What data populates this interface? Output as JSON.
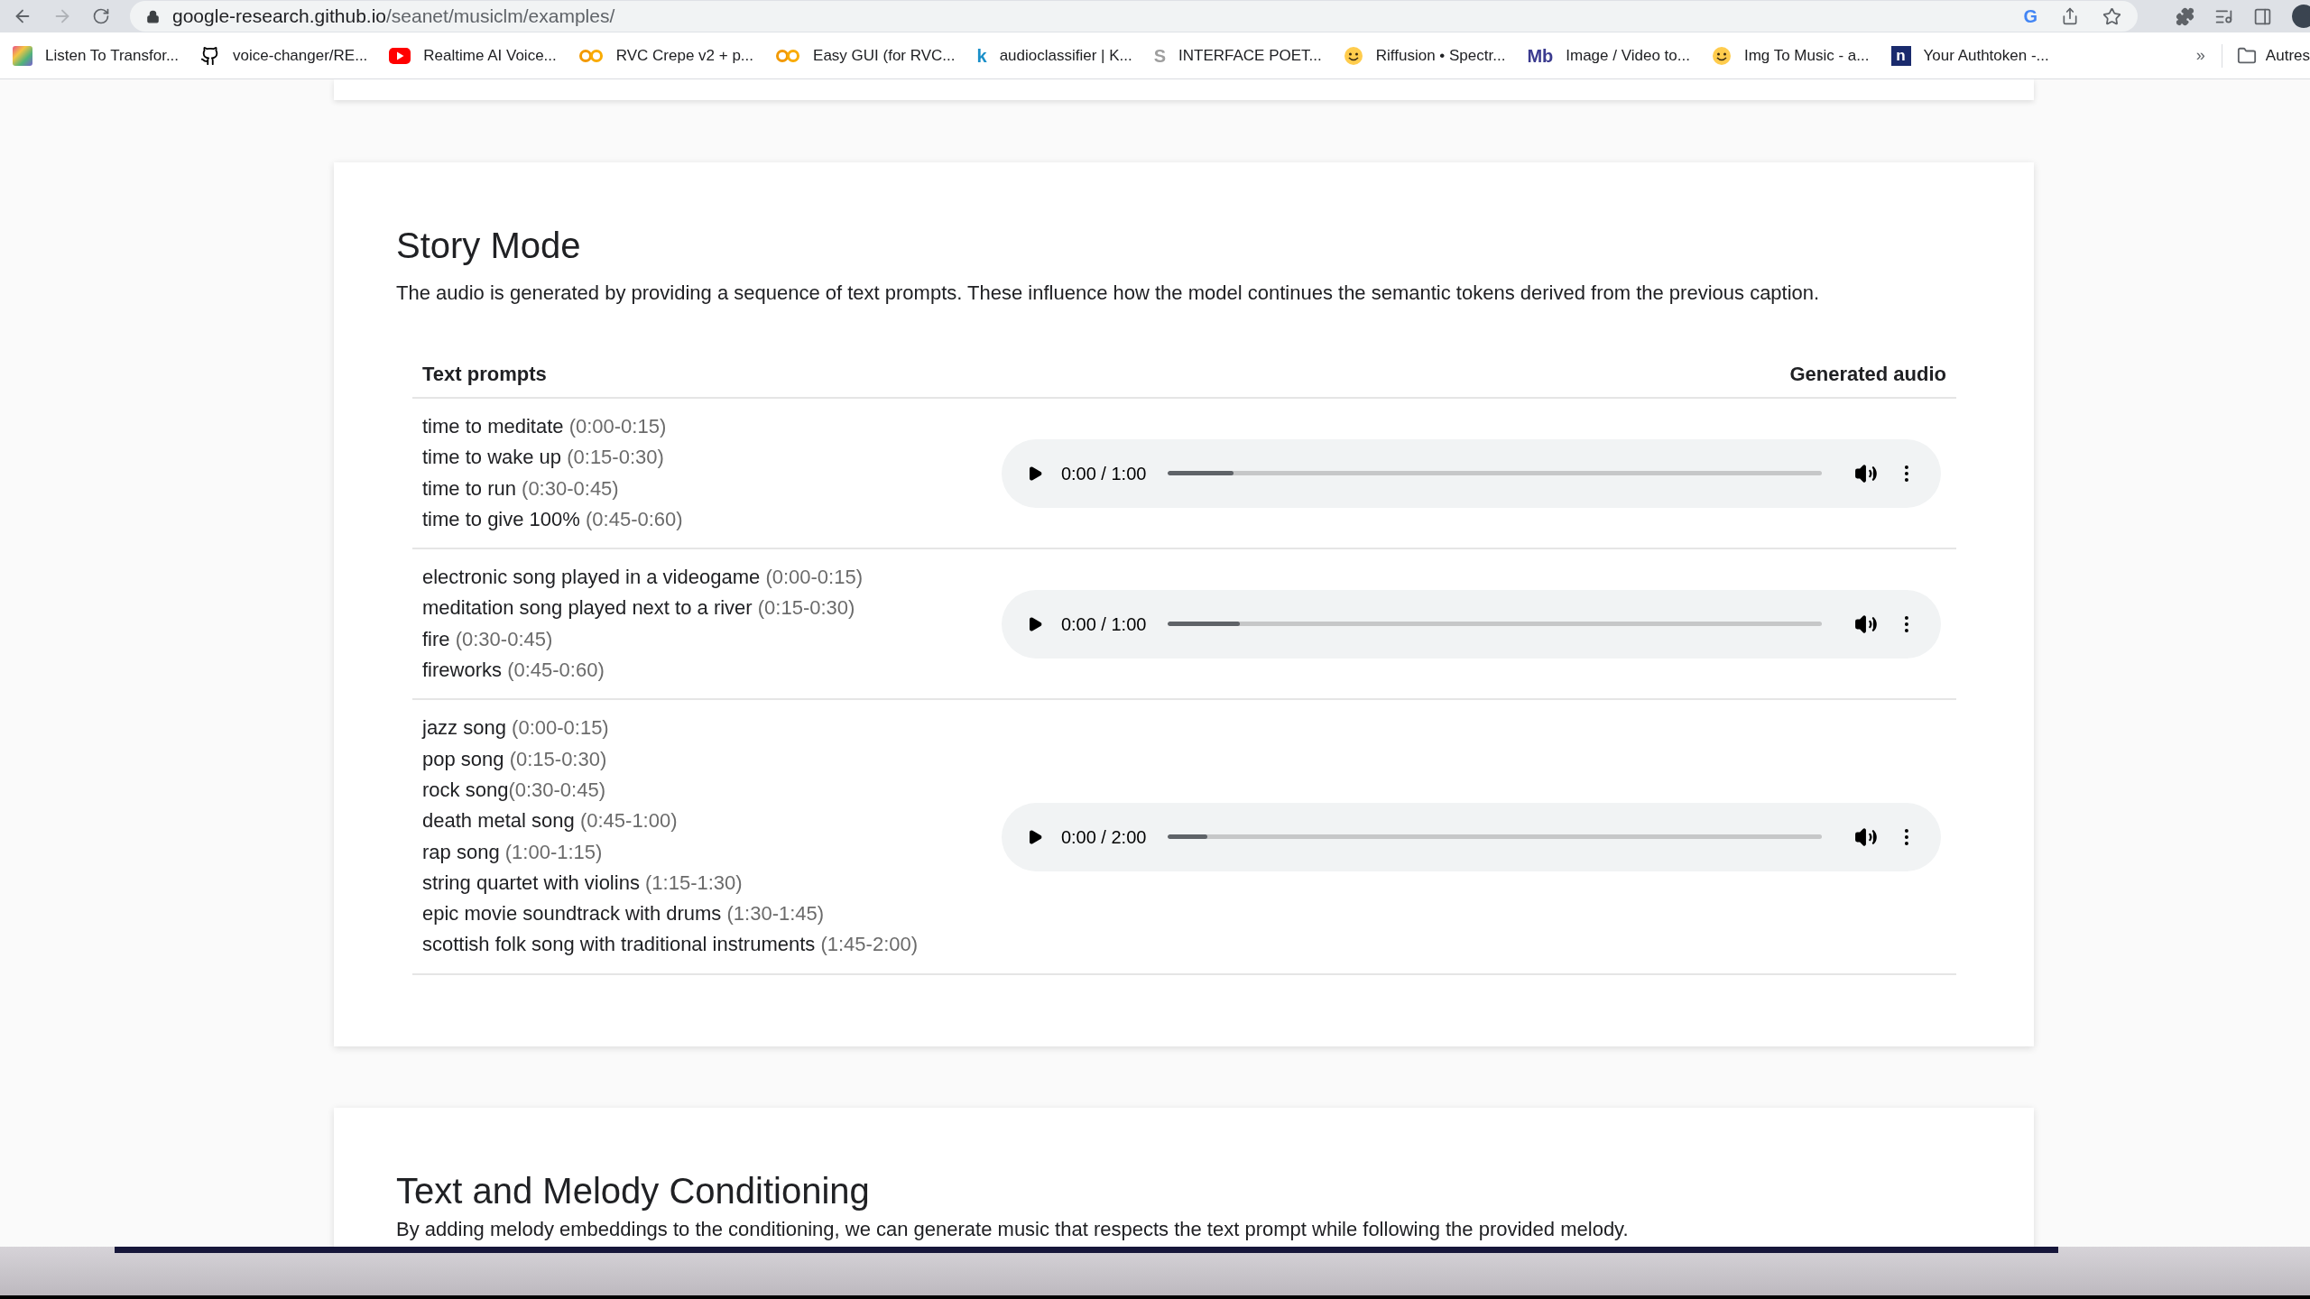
{
  "browser": {
    "url_host": "google-research.github.io",
    "url_path": "/seanet/musiclm/examples/",
    "google_glyph": "G"
  },
  "bookmarks": [
    {
      "kind": "image",
      "label": "Listen To Transfor..."
    },
    {
      "kind": "github",
      "label": "voice-changer/RE..."
    },
    {
      "kind": "youtube",
      "label": "Realtime AI Voice..."
    },
    {
      "kind": "colab",
      "label": "RVC Crepe v2 + p..."
    },
    {
      "kind": "colab",
      "label": "Easy GUI (for RVC..."
    },
    {
      "kind": "letter",
      "glyph": "k",
      "color": "#1a8fc9",
      "label": "audioclassifier | K..."
    },
    {
      "kind": "letter",
      "glyph": "S",
      "color": "#9e9e9e",
      "label": "INTERFACE POET..."
    },
    {
      "kind": "hf",
      "label": "Riffusion • Spectr..."
    },
    {
      "kind": "letter",
      "glyph": "Mb",
      "color": "#3b3b8f",
      "label": "Image / Video to..."
    },
    {
      "kind": "hf",
      "label": "Img To Music - a..."
    },
    {
      "kind": "box",
      "glyph": "n",
      "label": "Your Authtoken -..."
    }
  ],
  "bookmarks_overflow": "»",
  "other_bookmarks": "Autres",
  "story": {
    "title": "Story Mode",
    "description": "The audio is generated by providing a sequence of text prompts. These influence how the model continues the semantic tokens derived from the previous caption.",
    "columns": [
      "Text prompts",
      "Generated audio"
    ],
    "rows": [
      {
        "prompts": [
          {
            "text": "time to meditate",
            "time": "(0:00-0:15)",
            "spaced": true
          },
          {
            "text": "time to wake up",
            "time": "(0:15-0:30)",
            "spaced": true
          },
          {
            "text": "time to run",
            "time": "(0:30-0:45)",
            "spaced": true
          },
          {
            "text": "time to give 100%",
            "time": "(0:45-0:60)",
            "spaced": true
          }
        ],
        "audio": {
          "time": "0:00 / 1:00",
          "level": 0.1
        }
      },
      {
        "prompts": [
          {
            "text": "electronic song played in a videogame",
            "time": "(0:00-0:15)",
            "spaced": true
          },
          {
            "text": "meditation song played next to a river",
            "time": "(0:15-0:30)",
            "spaced": true
          },
          {
            "text": "fire",
            "time": "(0:30-0:45)",
            "spaced": true
          },
          {
            "text": "fireworks",
            "time": "(0:45-0:60)",
            "spaced": true
          }
        ],
        "audio": {
          "time": "0:00 / 1:00",
          "level": 0.11
        }
      },
      {
        "prompts": [
          {
            "text": "jazz song",
            "time": "(0:00-0:15)",
            "spaced": true
          },
          {
            "text": "pop song",
            "time": "(0:15-0:30)",
            "spaced": true
          },
          {
            "text": "rock song",
            "time": "(0:30-0:45)",
            "spaced": false
          },
          {
            "text": "death metal song",
            "time": "(0:45-1:00)",
            "spaced": true
          },
          {
            "text": "rap song",
            "time": "(1:00-1:15)",
            "spaced": true
          },
          {
            "text": "string quartet with violins",
            "time": "(1:15-1:30)",
            "spaced": true
          },
          {
            "text": "epic movie soundtrack with drums",
            "time": "(1:30-1:45)",
            "spaced": true
          },
          {
            "text": "scottish folk song with traditional instruments",
            "time": "(1:45-2:00)",
            "spaced": true
          }
        ],
        "audio": {
          "time": "0:00 / 2:00",
          "level": 0.06
        }
      }
    ]
  },
  "next_section": {
    "title": "Text and Melody Conditioning",
    "description": "By adding melody embeddings to the conditioning, we can generate music that respects the text prompt while following the provided melody."
  }
}
